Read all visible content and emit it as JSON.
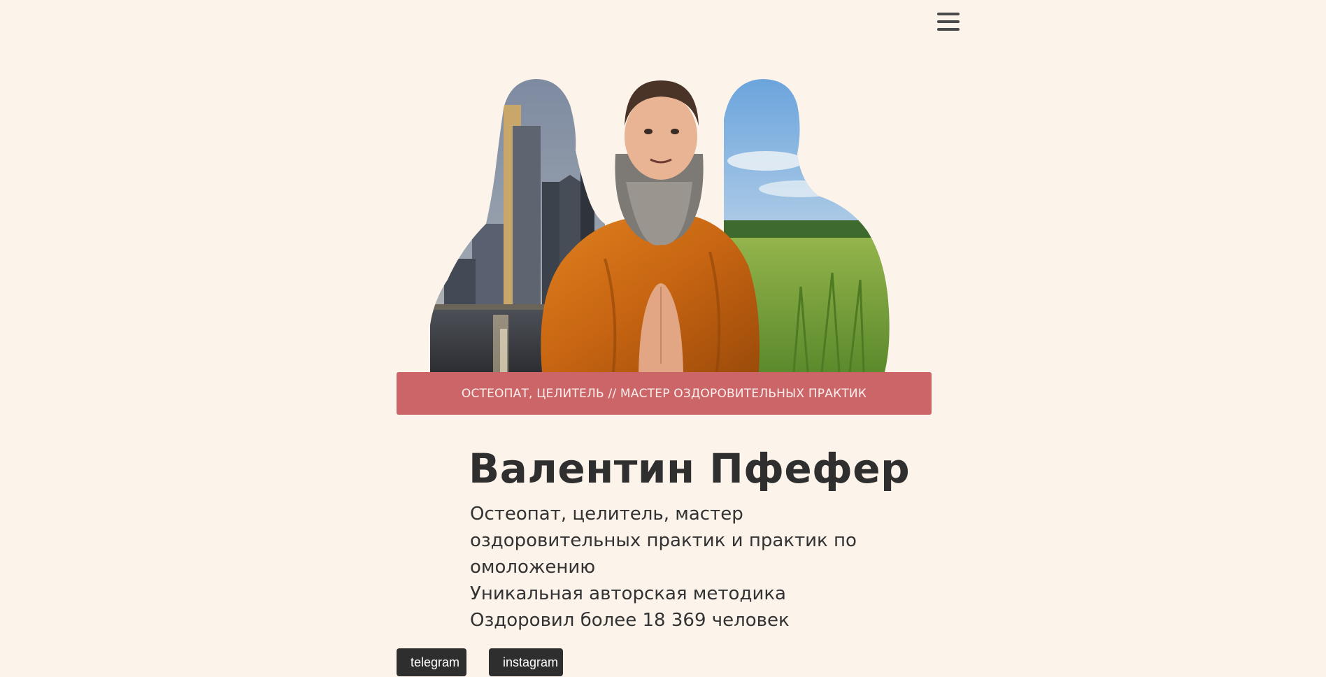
{
  "header": {
    "menu_icon": "hamburger-menu-icon"
  },
  "hero": {
    "image_description_icon": "portrait-collage",
    "tagline": "ОСТЕОПАТ, ЦЕЛИТЕЛЬ // МАСТЕР ОЗДОРОВИТЕЛЬНЫХ ПРАКТИК"
  },
  "profile": {
    "name": "Валентин Пфефер",
    "description": [
      "Остеопат, целитель, мастер оздоровительных практик и практик по омоложению",
      "Уникальная авторская методика",
      "Оздоровил более 18 369 человек"
    ]
  },
  "social": {
    "telegram_label": "telegram",
    "telegram_icon": "paper-plane-icon",
    "instagram_label": "instagram",
    "instagram_icon": "instagram-icon"
  },
  "colors": {
    "background": "#fcf3ea",
    "accent": "#cc6567",
    "text": "#2f2f2f",
    "button": "#2e2e2e"
  }
}
